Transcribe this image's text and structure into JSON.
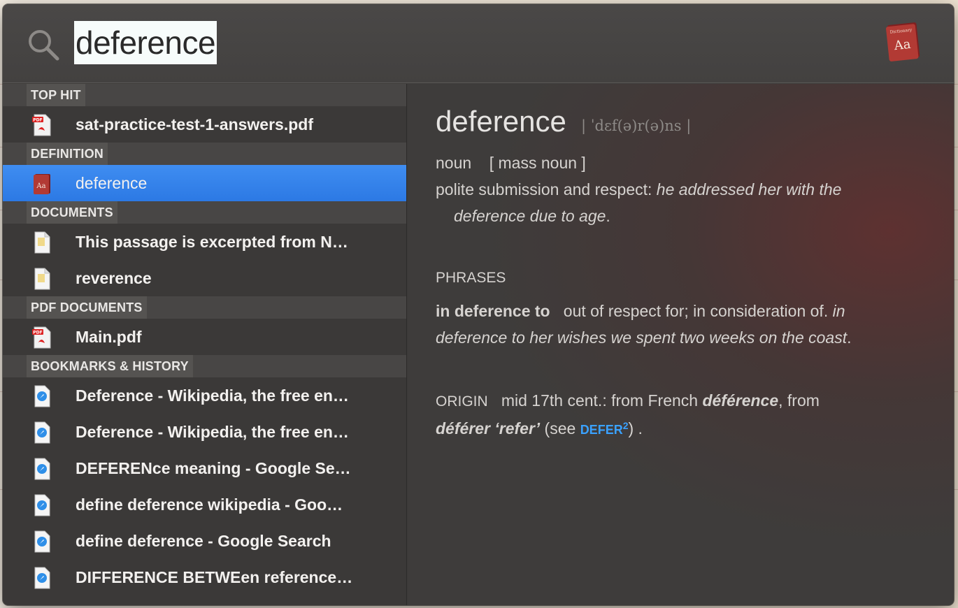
{
  "search": {
    "query": "deference"
  },
  "sections": [
    {
      "header": "TOP HIT",
      "items": [
        {
          "label": "sat-practice-test-1-answers.pdf",
          "icon": "pdf-icon"
        }
      ]
    },
    {
      "header": "DEFINITION",
      "items": [
        {
          "label": "deference",
          "icon": "dictionary-icon",
          "selected": true
        }
      ]
    },
    {
      "header": "DOCUMENTS",
      "items": [
        {
          "label": "This passage is excerpted from N…",
          "icon": "document-icon"
        },
        {
          "label": "reverence",
          "icon": "document-icon"
        }
      ]
    },
    {
      "header": "PDF DOCUMENTS",
      "items": [
        {
          "label": "Main.pdf",
          "icon": "pdf-icon"
        }
      ]
    },
    {
      "header": "BOOKMARKS & HISTORY",
      "items": [
        {
          "label": "Deference - Wikipedia, the free en…",
          "icon": "webloc-icon"
        },
        {
          "label": "Deference - Wikipedia, the free en…",
          "icon": "webloc-icon"
        },
        {
          "label": "DEFERENce meaning - Google Se…",
          "icon": "webloc-icon"
        },
        {
          "label": "define deference wikipedia - Goo…",
          "icon": "webloc-icon"
        },
        {
          "label": "define deference - Google Search",
          "icon": "webloc-icon"
        },
        {
          "label": "DIFFERENCE BETWEen reference…",
          "icon": "webloc-icon"
        }
      ]
    }
  ],
  "preview": {
    "headword": "deference",
    "pronunciation": "| ˈdɛf(ə)r(ə)ns |",
    "pos": "noun",
    "grammar": "[ mass noun ]",
    "definition": "polite submission and respect:",
    "example_1": "he addressed her with the",
    "example_2": "deference due to age",
    "period": ".",
    "phrases_heading": "PHRASES",
    "phrase_term": "in deference to",
    "phrase_def": "out of respect for; in consideration of.",
    "phrase_example_1": "in",
    "phrase_example_2": "deference to her wishes we spent two weeks on the coast",
    "origin_heading": "ORIGIN",
    "origin_text_1": "mid 17th cent.: from French",
    "origin_word_1": "déférence",
    "origin_text_2": ", from",
    "origin_word_2": "déférer ‘refer’",
    "origin_text_3": "(see",
    "origin_link": "DEFER",
    "origin_link_sup": "2",
    "origin_text_4": ") ."
  },
  "colors": {
    "selection": "#2c79e4",
    "link": "#3aa2ff",
    "panel": "#3d3b3a"
  }
}
